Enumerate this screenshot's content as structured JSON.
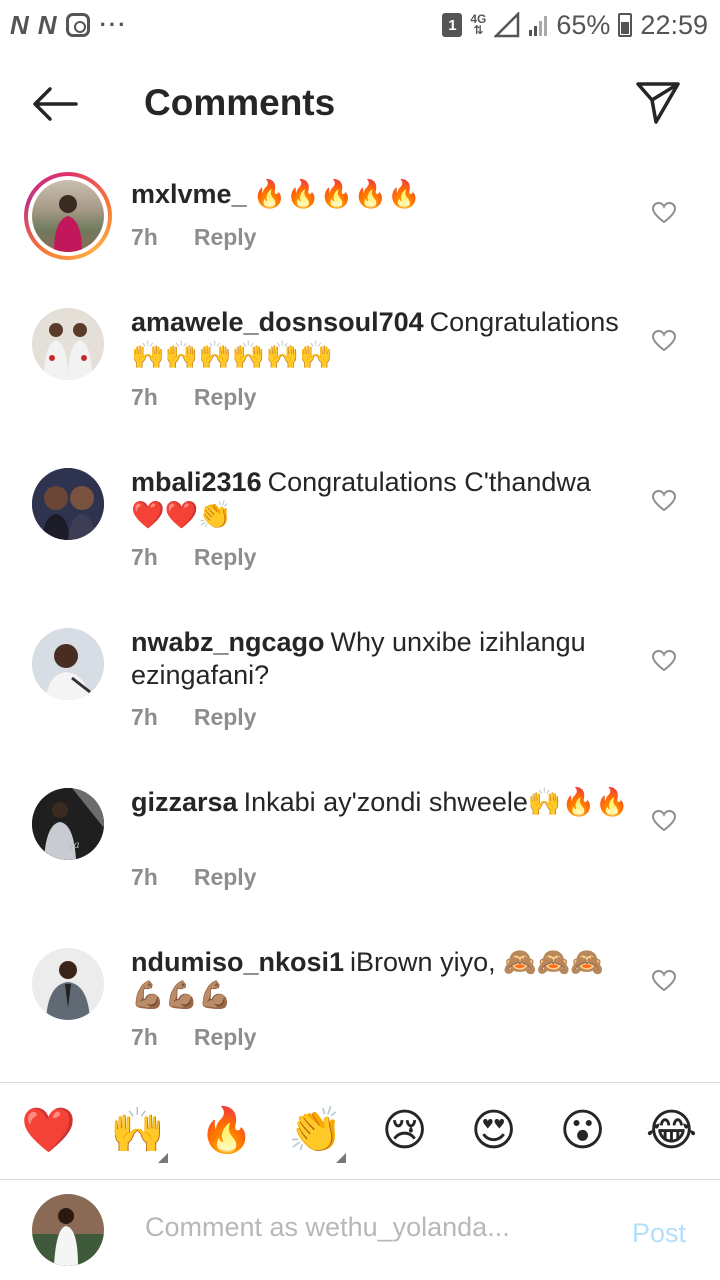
{
  "status_bar": {
    "sim_badge": "1",
    "network_top": "4G",
    "network_bottom": "⇅",
    "battery": "65%",
    "time": "22:59"
  },
  "header": {
    "title": "Comments"
  },
  "comments": [
    {
      "username": "mxlvme_",
      "text": "🔥🔥🔥🔥🔥",
      "time": "7h",
      "reply": "Reply"
    },
    {
      "username": "amawele_dosnsoul704",
      "text": "Congratulations 🙌🙌🙌🙌🙌🙌",
      "time": "7h",
      "reply": "Reply"
    },
    {
      "username": "mbali2316",
      "text": "Congratulations C'thandwa ❤️❤️👏",
      "time": "7h",
      "reply": "Reply"
    },
    {
      "username": "nwabz_ngcago",
      "text": "Why unxibe izihlangu ezingafani?",
      "time": "7h",
      "reply": "Reply"
    },
    {
      "username": "gizzarsa",
      "text": "Inkabi ay'zondi shweele🙌🔥🔥",
      "time": "7h",
      "reply": "Reply"
    },
    {
      "username": "ndumiso_nkosi1",
      "text": "iBrown yiyo, 🙈🙈🙈💪🏽💪🏽💪🏽",
      "time": "7h",
      "reply": "Reply"
    }
  ],
  "emoji_bar": [
    "❤️",
    "🙌",
    "🔥",
    "👏",
    "😢",
    "😍",
    "😮",
    "😂"
  ],
  "comment_input": {
    "placeholder": "Comment as wethu_yolanda...",
    "post_label": "Post"
  },
  "colors": {
    "post_disabled": "#b2dffc",
    "meta_gray": "#8e8e8e",
    "story_ring": "#e1306c"
  }
}
